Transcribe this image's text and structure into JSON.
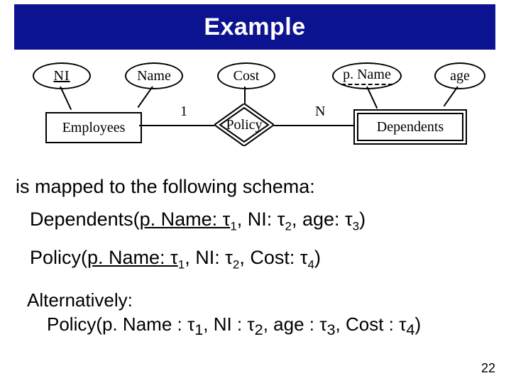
{
  "title": "Example",
  "er": {
    "attrs": {
      "ni": "NI",
      "name": "Name",
      "cost": "Cost",
      "pname": "p. Name",
      "age": "age"
    },
    "entities": {
      "employees": "Employees",
      "dependents": "Dependents"
    },
    "rel": {
      "policy": "Policy"
    },
    "card": {
      "left": "1",
      "right": "N"
    }
  },
  "mapping_intro": "is mapped to the following schema:",
  "schema": {
    "dependents": {
      "head": "Dependents(",
      "p1": "p. Name: τ",
      "s1": "1",
      "p2": ", NI: τ",
      "s2": "2",
      "p3": ", age: τ",
      "s3": "3",
      "tail": ")"
    },
    "policy": {
      "head": "Policy(",
      "p1": "p. Name: τ",
      "s1": "1",
      "p2": ", NI: τ",
      "s2": "2",
      "p3": ", Cost: τ",
      "s3": "4",
      "tail": ")"
    }
  },
  "alt": {
    "label": "Alternatively:",
    "line": {
      "head": "Policy(p. Name  : τ",
      "s1": "1",
      "p2": ", NI  : τ",
      "s2": "2",
      "p3": ", age  : τ",
      "s3": "3",
      "p4": ", Cost  : τ",
      "s4": "4",
      "tail": ")"
    }
  },
  "slide_number": "22"
}
